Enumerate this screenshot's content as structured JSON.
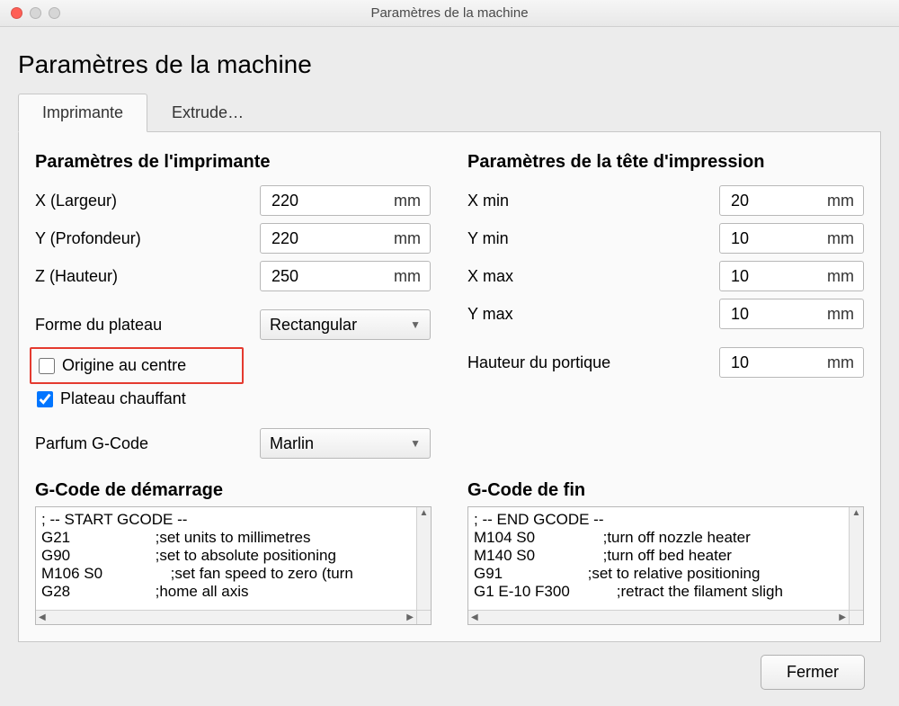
{
  "window": {
    "title": "Paramètres de la machine"
  },
  "page": {
    "title": "Paramètres de la machine"
  },
  "tabs": {
    "printer": "Imprimante",
    "extruder": "Extrude…"
  },
  "sections": {
    "printer_settings": "Paramètres de l'imprimante",
    "printhead_settings": "Paramètres de la tête d'impression",
    "start_gcode": "G-Code de démarrage",
    "end_gcode": "G-Code de fin"
  },
  "unit_mm": "mm",
  "printer": {
    "x_width_label": "X (Largeur)",
    "x_width_value": "220",
    "y_depth_label": "Y (Profondeur)",
    "y_depth_value": "220",
    "z_height_label": "Z (Hauteur)",
    "z_height_value": "250",
    "buildplate_shape_label": "Forme du plateau",
    "buildplate_shape_value": "Rectangular",
    "origin_center_label": "Origine au centre",
    "origin_center_checked": false,
    "heated_bed_label": "Plateau chauffant",
    "heated_bed_checked": true,
    "gcode_flavor_label": "Parfum G-Code",
    "gcode_flavor_value": "Marlin"
  },
  "printhead": {
    "x_min_label": "X min",
    "x_min_value": "20",
    "y_min_label": "Y min",
    "y_min_value": "10",
    "x_max_label": "X max",
    "x_max_value": "10",
    "y_max_label": "Y max",
    "y_max_value": "10",
    "gantry_height_label": "Hauteur du portique",
    "gantry_height_value": "10"
  },
  "start_gcode": "; -- START GCODE --\nG21                    ;set units to millimetres\nG90                    ;set to absolute positioning\nM106 S0                ;set fan speed to zero (turn\nG28                    ;home all axis",
  "end_gcode": "; -- END GCODE --\nM104 S0                ;turn off nozzle heater\nM140 S0                ;turn off bed heater\nG91                    ;set to relative positioning\nG1 E-10 F300           ;retract the filament sligh",
  "footer": {
    "close": "Fermer"
  }
}
